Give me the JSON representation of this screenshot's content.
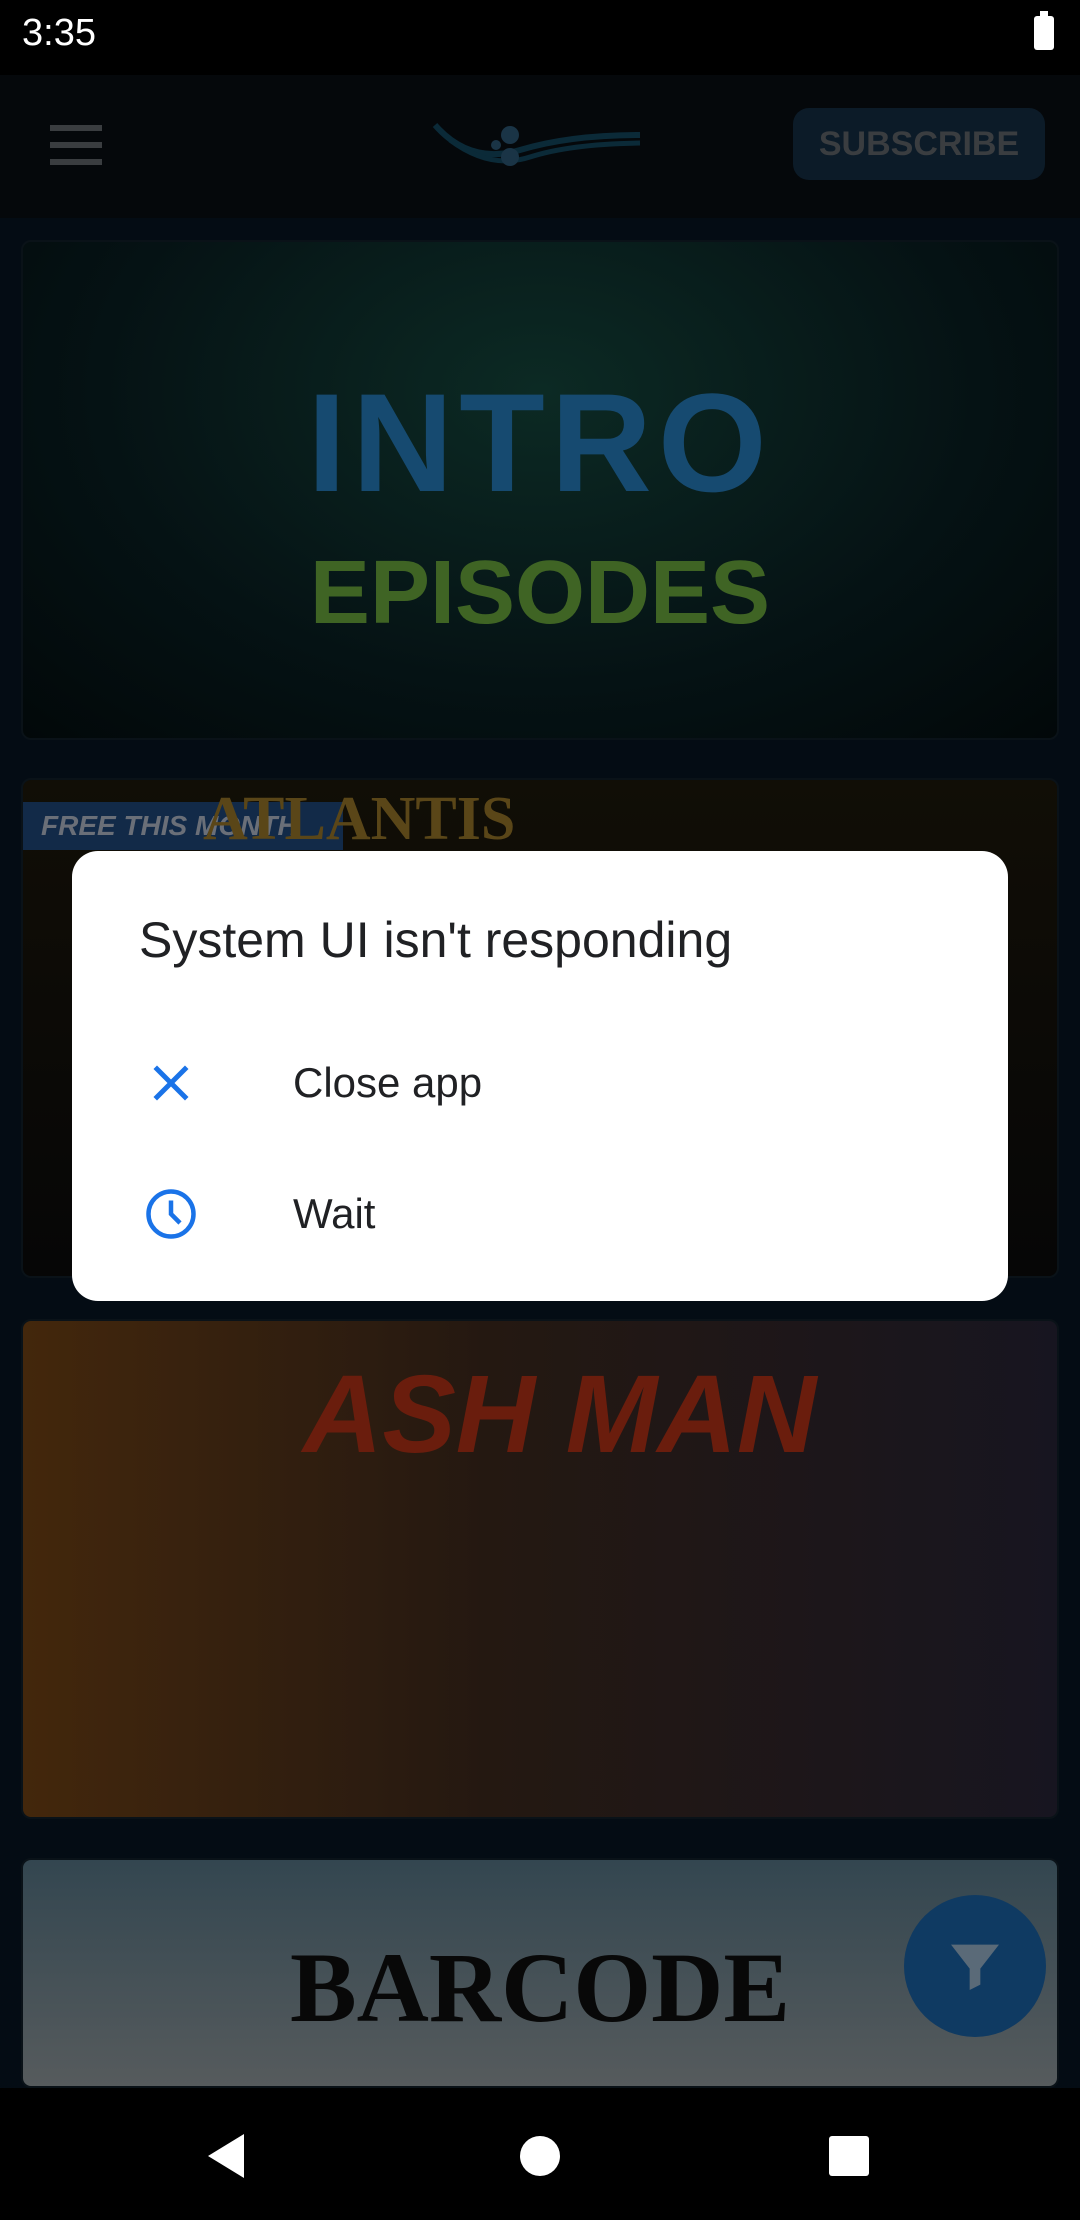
{
  "status_bar": {
    "time": "3:35",
    "battery_icon": "battery-full-icon"
  },
  "app_bar": {
    "menu_icon": "hamburger-menu-icon",
    "logo": "wave-logo",
    "subscribe_label": "SUBSCRIBE"
  },
  "cards": [
    {
      "title": "INTRO",
      "subtitle": "EPISODES"
    },
    {
      "badge": "FREE THIS MONTH",
      "title": "ATLANTIS"
    },
    {
      "title": "ASH MAN"
    },
    {
      "title": "BARCODE"
    }
  ],
  "fab": {
    "icon": "filter-icon"
  },
  "dialog": {
    "title": "System UI isn't responding",
    "options": [
      {
        "label": "Close app",
        "icon": "close-icon"
      },
      {
        "label": "Wait",
        "icon": "clock-icon"
      }
    ],
    "accent": "#1a73e8"
  },
  "nav_bar": {
    "back": "back-icon",
    "home": "home-icon",
    "recents": "recents-icon"
  }
}
